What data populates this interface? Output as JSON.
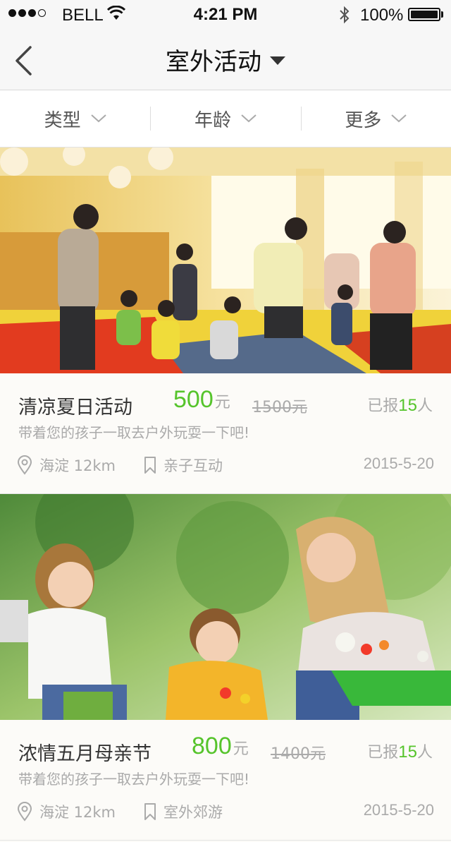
{
  "status_bar": {
    "carrier": "BELL",
    "time": "4:21 PM",
    "battery": "100%"
  },
  "nav": {
    "title": "室外活动"
  },
  "filters": [
    {
      "label": "类型"
    },
    {
      "label": "年龄"
    },
    {
      "label": "更多"
    }
  ],
  "activities": [
    {
      "name": "清凉夏日活动",
      "price": "500",
      "unit": "元",
      "old_price": "1500元",
      "enrolled_prefix": "已报",
      "enrolled_count": "15",
      "enrolled_suffix": "人",
      "slogan": "带着您的孩子一取去户外玩耍一下吧!",
      "location": "海淀 12km",
      "category": "亲子互动",
      "date": "2015-5-20"
    },
    {
      "name": "浓情五月母亲节",
      "price": "800",
      "unit": "元",
      "old_price": "1400元",
      "enrolled_prefix": "已报",
      "enrolled_count": "15",
      "enrolled_suffix": "人",
      "slogan": "带着您的孩子一取去户外玩耍一下吧!",
      "location": "海淀 12km",
      "category": "室外郊游",
      "date": "2015-5-20"
    }
  ],
  "colors": {
    "accent_green": "#56c42c",
    "muted_text": "#aaaaaa"
  }
}
